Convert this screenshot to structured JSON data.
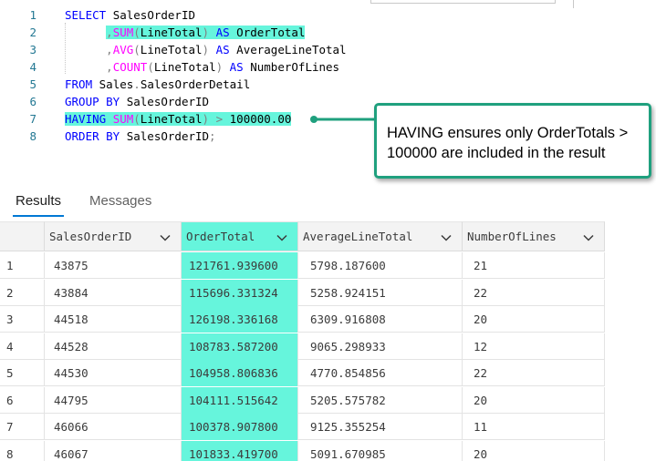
{
  "editor": {
    "line_numbers": [
      "1",
      "2",
      "3",
      "4",
      "5",
      "6",
      "7",
      "8"
    ],
    "lines": [
      {
        "parts": [
          [
            "kw",
            "SELECT "
          ],
          [
            "pl",
            "SalesOrderID"
          ]
        ]
      },
      {
        "parts": [
          [
            "pl",
            "      "
          ],
          [
            "gr",
            ","
          ],
          [
            "fn",
            "SUM"
          ],
          [
            "gr",
            "("
          ],
          [
            "pl",
            "LineTotal"
          ],
          [
            "gr",
            ")"
          ],
          [
            "pl",
            " "
          ],
          [
            "kw",
            "AS "
          ],
          [
            "pl",
            "OrderTotal"
          ]
        ],
        "highlight": true
      },
      {
        "parts": [
          [
            "pl",
            "      "
          ],
          [
            "gr",
            ","
          ],
          [
            "fn",
            "AVG"
          ],
          [
            "gr",
            "("
          ],
          [
            "pl",
            "LineTotal"
          ],
          [
            "gr",
            ")"
          ],
          [
            "pl",
            " "
          ],
          [
            "kw",
            "AS "
          ],
          [
            "pl",
            "AverageLineTotal"
          ]
        ]
      },
      {
        "parts": [
          [
            "pl",
            "      "
          ],
          [
            "gr",
            ","
          ],
          [
            "fn",
            "COUNT"
          ],
          [
            "gr",
            "("
          ],
          [
            "pl",
            "LineTotal"
          ],
          [
            "gr",
            ")"
          ],
          [
            "pl",
            " "
          ],
          [
            "kw",
            "AS "
          ],
          [
            "pl",
            "NumberOfLines"
          ]
        ]
      },
      {
        "parts": [
          [
            "kw",
            "FROM "
          ],
          [
            "pl",
            "Sales"
          ],
          [
            "gr",
            "."
          ],
          [
            "pl",
            "SalesOrderDetail"
          ]
        ]
      },
      {
        "parts": [
          [
            "kw",
            "GROUP BY "
          ],
          [
            "pl",
            "SalesOrderID"
          ]
        ]
      },
      {
        "parts": [
          [
            "kw",
            "HAVING "
          ],
          [
            "fn",
            "SUM"
          ],
          [
            "gr",
            "("
          ],
          [
            "pl",
            "LineTotal"
          ],
          [
            "gr",
            ")"
          ],
          [
            "pl",
            " "
          ],
          [
            "gr",
            "> "
          ],
          [
            "pl",
            "100000.00"
          ]
        ],
        "highlight": true
      },
      {
        "parts": [
          [
            "kw",
            "ORDER BY "
          ],
          [
            "pl",
            "SalesOrderID"
          ],
          [
            "gr",
            ";"
          ]
        ]
      }
    ]
  },
  "callout": {
    "text": "HAVING ensures  only OrderTotals > 100000 are included in the result",
    "border_color": "#1fa07e"
  },
  "tabs": [
    {
      "label": "Results",
      "active": true
    },
    {
      "label": "Messages",
      "active": false
    }
  ],
  "grid": {
    "columns": [
      "SalesOrderID",
      "OrderTotal",
      "AverageLineTotal",
      "NumberOfLines"
    ],
    "selected_column": "OrderTotal",
    "rows": [
      [
        "1",
        "43875",
        "121761.939600",
        "5798.187600",
        "21"
      ],
      [
        "2",
        "43884",
        "115696.331324",
        "5258.924151",
        "22"
      ],
      [
        "3",
        "44518",
        "126198.336168",
        "6309.916808",
        "20"
      ],
      [
        "4",
        "44528",
        "108783.587200",
        "9065.298933",
        "12"
      ],
      [
        "5",
        "44530",
        "104958.806836",
        "4770.854856",
        "22"
      ],
      [
        "6",
        "44795",
        "104111.515642",
        "5205.575782",
        "20"
      ],
      [
        "7",
        "46066",
        "100378.907800",
        "9125.355254",
        "11"
      ],
      [
        "8",
        "46067",
        "101833.419700",
        "5091.670985",
        "20"
      ]
    ]
  },
  "colors": {
    "highlight": "#66f5dc",
    "keyword": "#0000ff",
    "function": "#ff00ff",
    "line_number": "#237893"
  }
}
